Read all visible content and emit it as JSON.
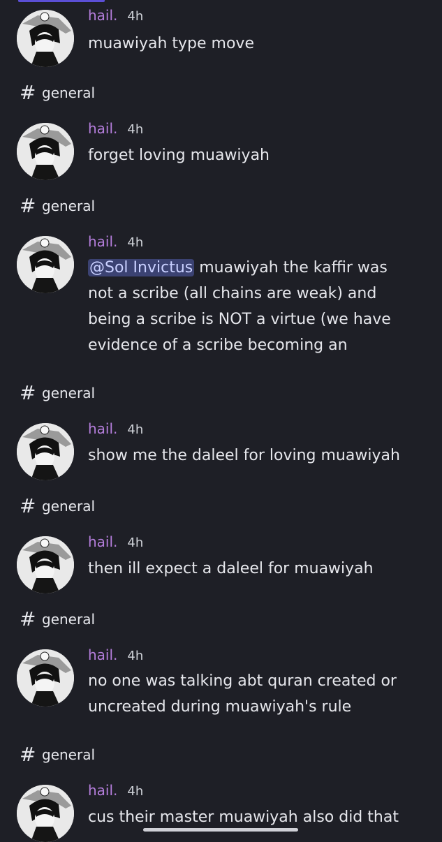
{
  "messages": [
    {
      "author": "hail.",
      "time": "4h",
      "lines": [
        "muawiyah type move"
      ],
      "channel_after": "general"
    },
    {
      "author": "hail.",
      "time": "4h",
      "lines": [
        "forget loving muawiyah"
      ],
      "channel_after": "general"
    },
    {
      "author": "hail.",
      "time": "4h",
      "mention": "@Sol Invictus",
      "lines": [
        "muawiyah the kaffir was",
        "not a scribe (all chains are weak) and",
        "being a scribe is NOT a virtue (we have",
        "evidence of a scribe becoming an"
      ],
      "channel_after": "general"
    },
    {
      "author": "hail.",
      "time": "4h",
      "lines": [
        "show me the daleel for loving muawiyah"
      ],
      "channel_after": "general"
    },
    {
      "author": "hail.",
      "time": "4h",
      "lines": [
        "then ill expect a daleel for muawiyah"
      ],
      "channel_after": "general"
    },
    {
      "author": "hail.",
      "time": "4h",
      "lines": [
        "no one was talking abt quran created or",
        "uncreated during muawiyah's rule"
      ],
      "channel_after": "general"
    },
    {
      "author": "hail.",
      "time": "4h",
      "lines": [
        "cus their master muawiyah also did that"
      ]
    }
  ],
  "channel_prefix": "#",
  "colors": {
    "background": "#1e1f26",
    "author": "#b57edc",
    "mention_bg": "#3b4272"
  }
}
